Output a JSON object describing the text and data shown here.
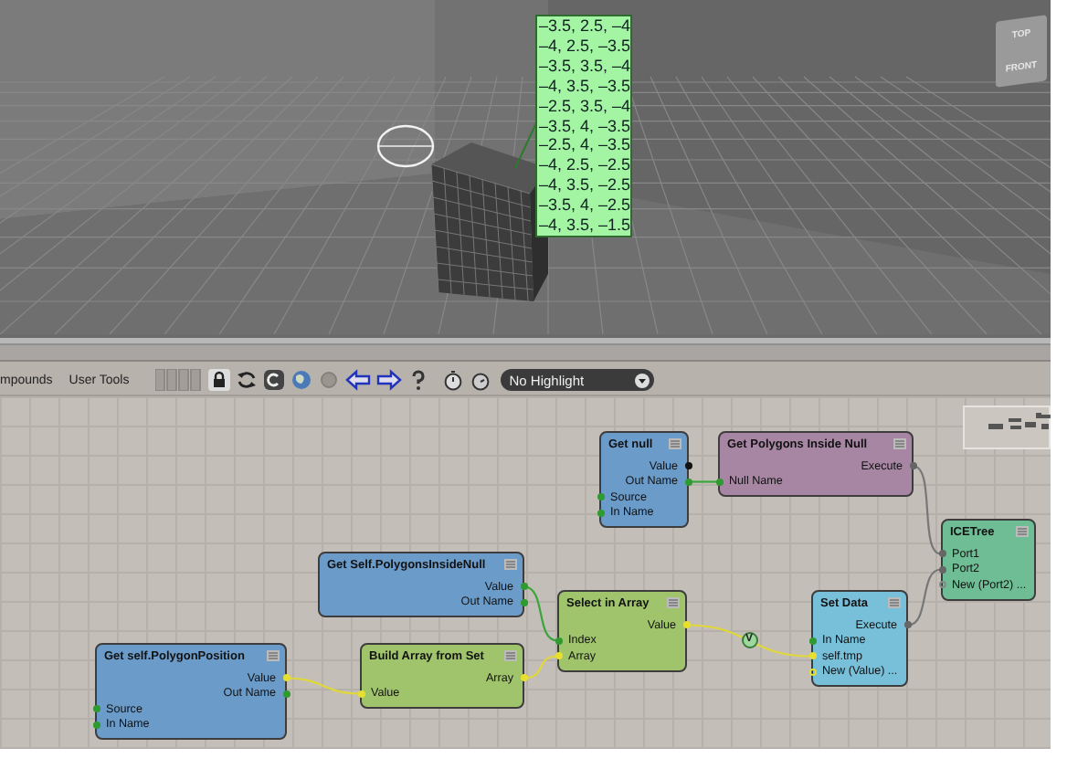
{
  "viewport": {
    "point_labels": [
      "–3.5,  2.5,  –4",
      "–4,  2.5,  –3.5",
      "–3.5,  3.5,  –4",
      "–4,  3.5,  –3.5",
      "–2.5,  3.5,  –4",
      "–3.5,  4,  –3.5",
      "–2.5,  4,  –3.5",
      "–4,  2.5,  –2.5",
      "–4,  3.5,  –2.5",
      "–3.5,  4,  –2.5",
      "–4,  3.5,  –1.5"
    ],
    "view_cube": {
      "top": "TOP",
      "front": "FRONT"
    }
  },
  "toolbar": {
    "tabs": [
      "mpounds",
      "User Tools"
    ],
    "highlight_dropdown": {
      "value": "No Highlight"
    }
  },
  "graph": {
    "nodes": [
      {
        "title": "Get null",
        "color": "#6b9cc9",
        "ports": [
          {
            "label": "Value",
            "kind": "output",
            "color": "#111111",
            "connected": true
          },
          {
            "label": "Out Name",
            "kind": "output",
            "color": "#2f9a2f",
            "connected": true
          },
          {
            "label": "Source",
            "kind": "input",
            "color": "#2f9a2f",
            "connected": true
          },
          {
            "label": "In Name",
            "kind": "input",
            "color": "#2f9a2f",
            "connected": true
          }
        ]
      },
      {
        "title": "Get Polygons Inside Null",
        "color": "#a786a4",
        "ports": [
          {
            "label": "Execute",
            "kind": "output",
            "color": "#666666",
            "connected": true
          },
          {
            "label": "Null Name",
            "kind": "input",
            "color": "#2f9a2f",
            "connected": true
          }
        ]
      },
      {
        "title": "ICETree",
        "color": "#6fbd95",
        "ports": [
          {
            "label": "Port1",
            "kind": "input",
            "color": "#666666",
            "connected": true
          },
          {
            "label": "Port2",
            "kind": "input",
            "color": "#666666",
            "connected": true
          },
          {
            "label": "New (Port2) ...",
            "kind": "input",
            "color": "#888888",
            "connected": false
          }
        ]
      },
      {
        "title": "Get Self.PolygonsInsideNull",
        "color": "#6b9cc9",
        "ports": [
          {
            "label": "Value",
            "kind": "output",
            "color": "#2f9a2f",
            "connected": true
          },
          {
            "label": "Out Name",
            "kind": "output",
            "color": "#2f9a2f",
            "connected": true
          }
        ]
      },
      {
        "title": "Get self.PolygonPosition",
        "color": "#6b9cc9",
        "ports": [
          {
            "label": "Value",
            "kind": "output",
            "color": "#e8e030",
            "connected": true
          },
          {
            "label": "Out Name",
            "kind": "output",
            "color": "#2f9a2f",
            "connected": true
          },
          {
            "label": "Source",
            "kind": "input",
            "color": "#2f9a2f",
            "connected": true
          },
          {
            "label": "In Name",
            "kind": "input",
            "color": "#2f9a2f",
            "connected": true
          }
        ]
      },
      {
        "title": "Build Array from Set",
        "color": "#a0c46c",
        "ports": [
          {
            "label": "Array",
            "kind": "output",
            "color": "#e8e030",
            "connected": true
          },
          {
            "label": "Value",
            "kind": "input",
            "color": "#e8e030",
            "connected": true
          }
        ]
      },
      {
        "title": "Select in Array",
        "color": "#a0c46c",
        "ports": [
          {
            "label": "Value",
            "kind": "output",
            "color": "#e8e030",
            "connected": true
          },
          {
            "label": "Index",
            "kind": "input",
            "color": "#2f9a2f",
            "connected": true
          },
          {
            "label": "Array",
            "kind": "input",
            "color": "#e8e030",
            "connected": true
          }
        ]
      },
      {
        "title": "Set Data",
        "color": "#78bfd9",
        "ports": [
          {
            "label": "Execute",
            "kind": "output",
            "color": "#666666",
            "connected": true
          },
          {
            "label": "In Name",
            "kind": "input",
            "color": "#2f9a2f",
            "connected": true
          },
          {
            "label": "self.tmp",
            "kind": "input",
            "color": "#e8e030",
            "connected": true
          },
          {
            "label": "New (Value) ...",
            "kind": "input",
            "color": "#e8e030",
            "connected": false
          }
        ]
      }
    ],
    "converter": {
      "label": "V"
    }
  }
}
